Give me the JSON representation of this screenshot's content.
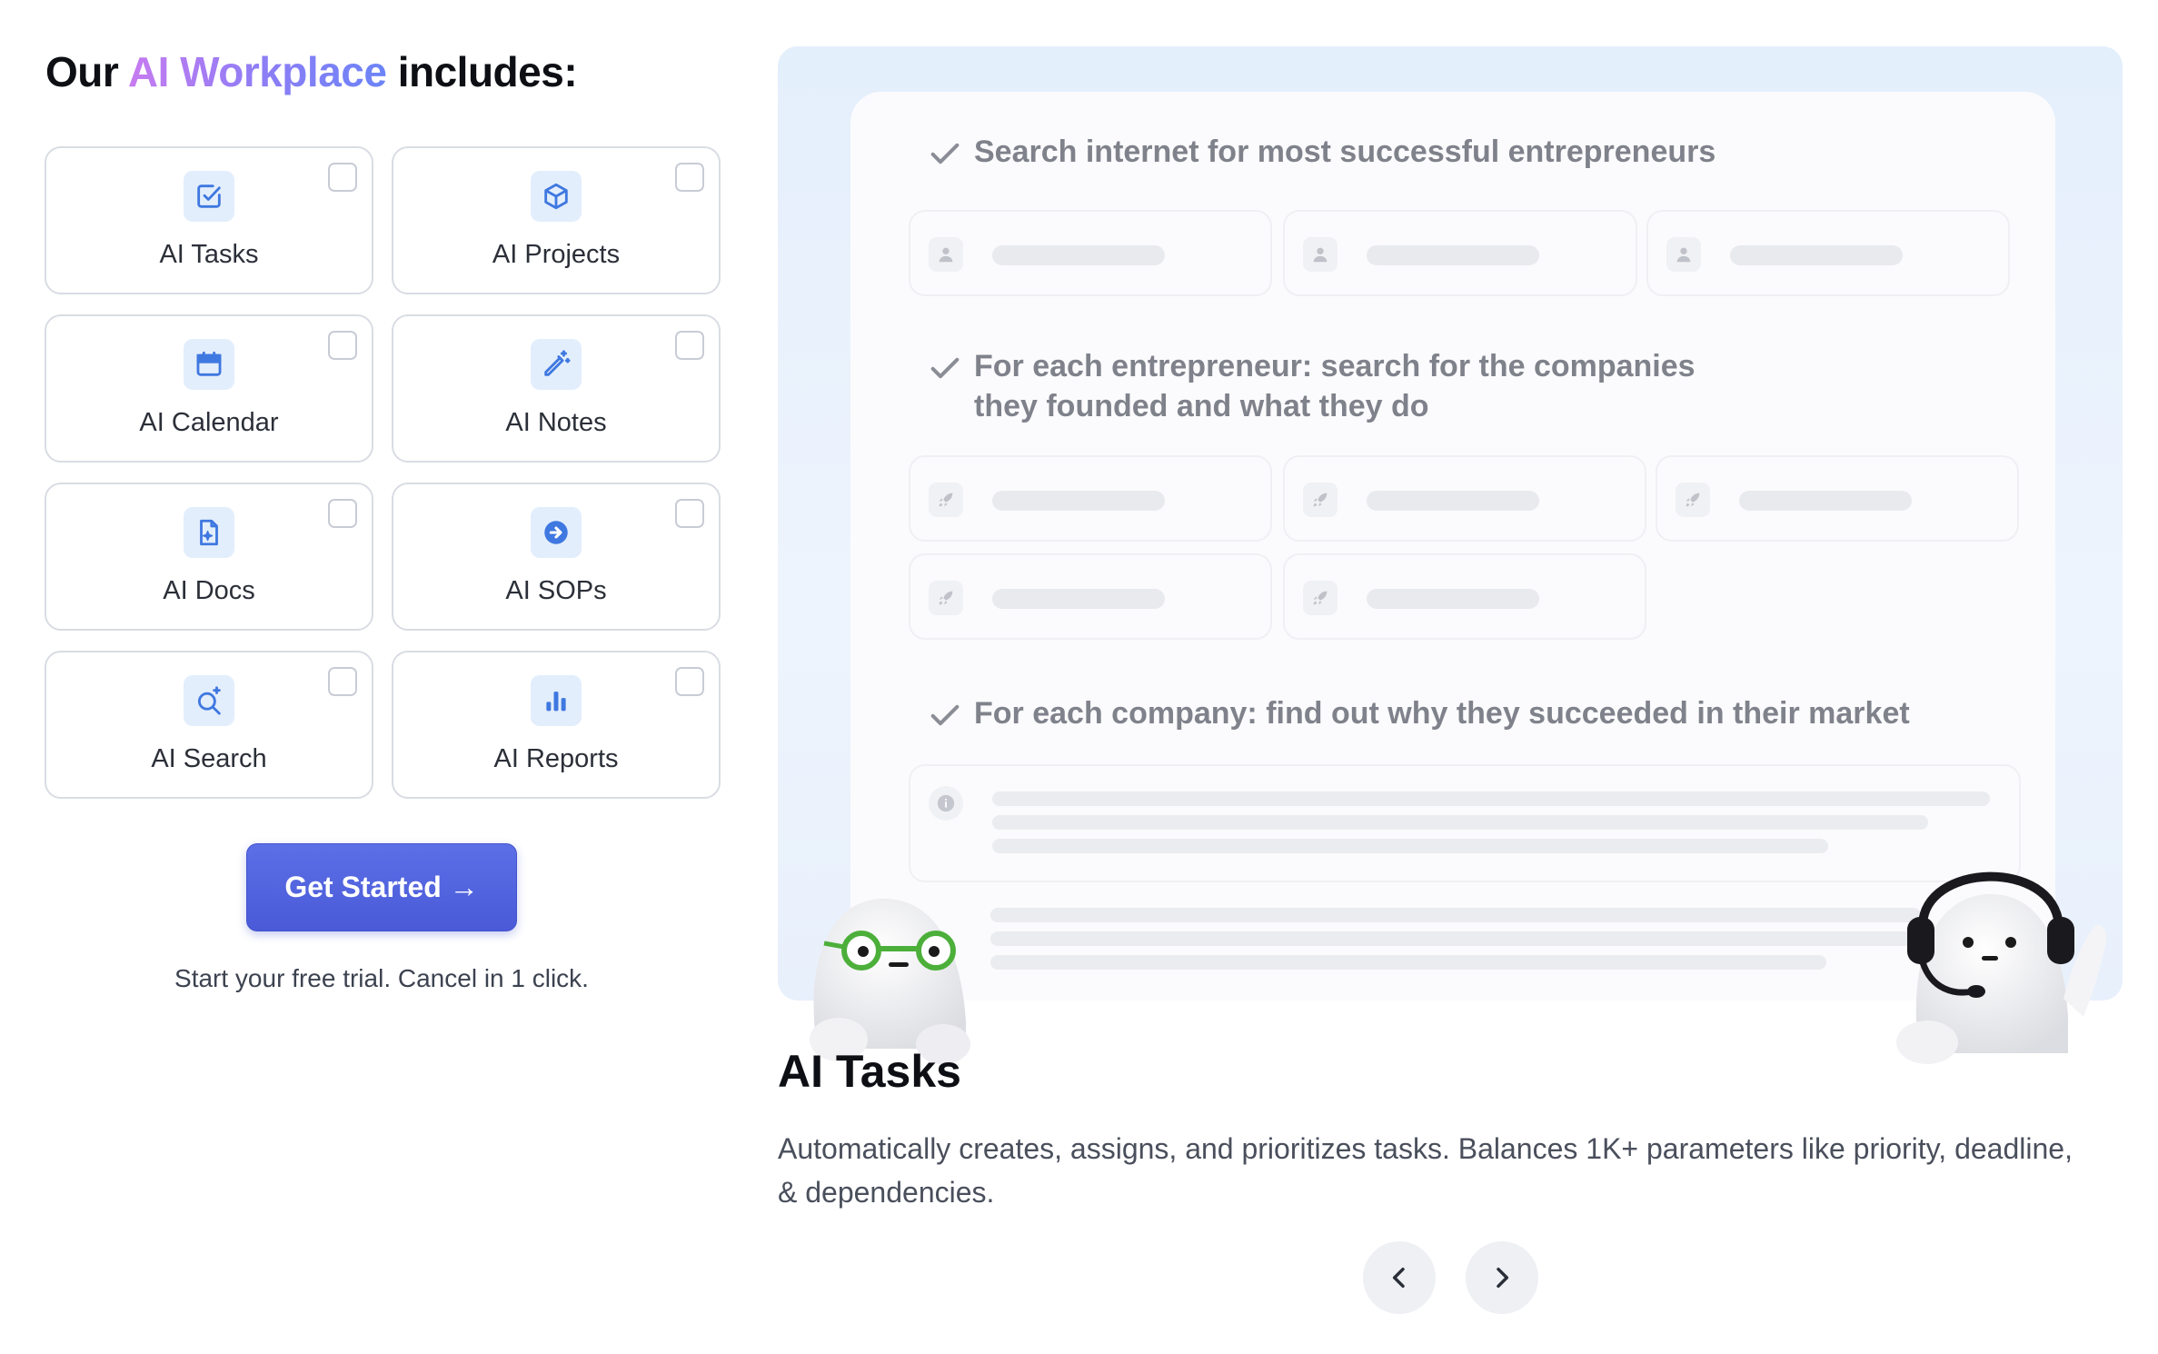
{
  "heading": {
    "prefix": "Our ",
    "highlight": "AI Workplace",
    "suffix": " includes:"
  },
  "features": [
    {
      "label": "AI Tasks",
      "icon": "checkbox-icon"
    },
    {
      "label": "AI Projects",
      "icon": "cube-icon"
    },
    {
      "label": "AI Calendar",
      "icon": "calendar-icon"
    },
    {
      "label": "AI Notes",
      "icon": "magic-pen-icon"
    },
    {
      "label": "AI Docs",
      "icon": "document-sparkle-icon"
    },
    {
      "label": "AI SOPs",
      "icon": "arrow-circle-icon"
    },
    {
      "label": "AI Search",
      "icon": "search-sparkle-icon"
    },
    {
      "label": "AI Reports",
      "icon": "bar-chart-icon"
    }
  ],
  "cta": {
    "label": "Get Started →",
    "subtext": "Start your free trial. Cancel in 1 click."
  },
  "preview": {
    "steps": [
      "Search internet for most successful entrepreneurs",
      "For each entrepreneur: search for the companies",
      "they founded and what they do",
      "For each company: find out why they succeeded in their market"
    ]
  },
  "feature_detail": {
    "title": "AI Tasks",
    "description": "Automatically creates, assigns, and prioritizes tasks. Balances 1K+ parameters like priority, deadline, & dependencies."
  },
  "colors": {
    "accent": "#4a5ad8",
    "icon_bg": "#e3eefc",
    "icon_fg": "#3f78e0",
    "gradient_start": "#c77bf0",
    "gradient_end": "#6b84f7"
  }
}
